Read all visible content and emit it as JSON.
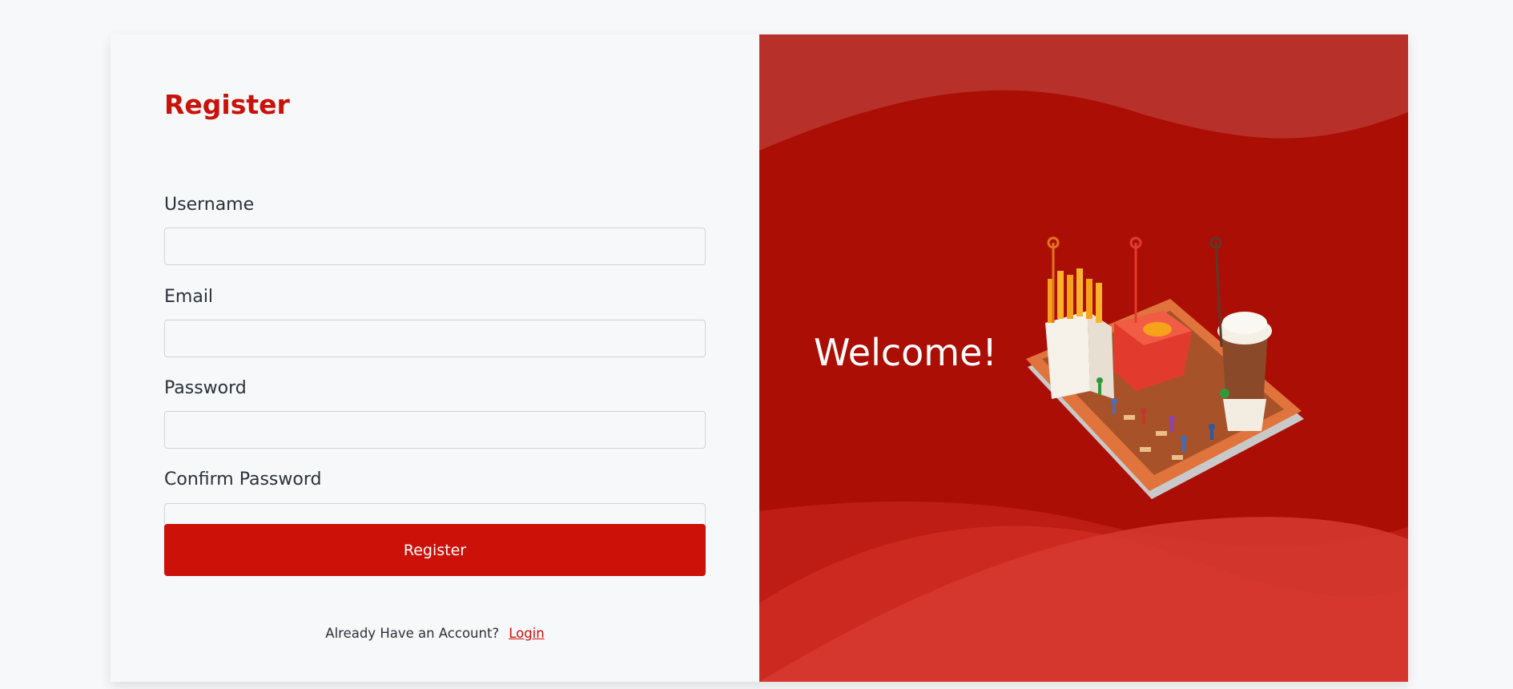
{
  "form": {
    "title": "Register",
    "fields": [
      {
        "label": "Username",
        "value": "",
        "placeholder": ""
      },
      {
        "label": "Email",
        "value": "",
        "placeholder": ""
      },
      {
        "label": "Password",
        "value": "",
        "placeholder": ""
      },
      {
        "label": "Confirm Password",
        "value": "",
        "placeholder": ""
      }
    ],
    "submit_label": "Register",
    "footer_text": "Already Have an Account?",
    "login_link": "Login"
  },
  "hero": {
    "welcome_text": "Welcome!",
    "illustration": "food-tray-illustration"
  },
  "colors": {
    "accent": "#cc1108",
    "hero_bg": "#ab0e05",
    "text": "#2b3138",
    "page_bg": "#f7f8fa"
  }
}
